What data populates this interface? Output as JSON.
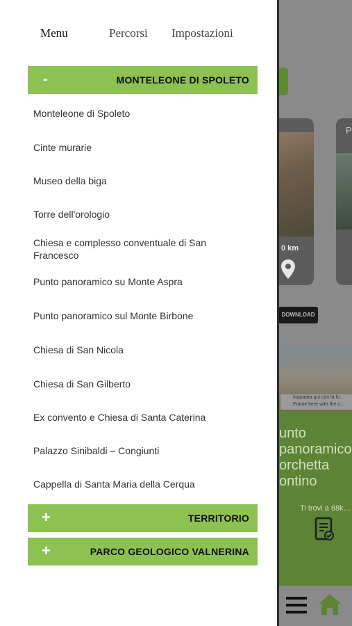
{
  "tabs": {
    "menu": "Menu",
    "percorsi": "Percorsi",
    "impostazioni": "Impostazioni"
  },
  "sections": [
    {
      "sign": "-",
      "title": "MONTELEONE DI SPOLETO",
      "expanded": true
    },
    {
      "sign": "+",
      "title": "TERRITORIO",
      "expanded": false
    },
    {
      "sign": "+",
      "title": "PARCO GEOLOGICO VALNERINA",
      "expanded": false
    }
  ],
  "items": [
    "Monteleone di Spoleto",
    "Cinte murarie",
    "Museo della biga",
    "Torre dell'orologio",
    "Chiesa e complesso conventuale di San Francesco",
    "Punto panoramico su Monte Aspra",
    "Punto panoramico sul Monte Birbone",
    "Chiesa di San Nicola",
    "Chiesa di San Gilberto",
    "Ex convento e Chiesa di Santa Caterina",
    "Palazzo Sinibaldi – Congiunti",
    "Cappella di Santa Maria della Cerqua"
  ],
  "background": {
    "distance_label": "0 km",
    "download_label": "DOWNLOAD",
    "card2_label": "P",
    "image_caption": "Inquadra qui con la fo… Frame here with the c…",
    "green_title": "unto\npanoramico\norchetta\nontino",
    "green_subtitle": "Ti trovi a 68k…"
  },
  "colors": {
    "accent_green": "#8dc152",
    "background_green": "#5d8436",
    "drawer_bg": "#ffffff"
  }
}
